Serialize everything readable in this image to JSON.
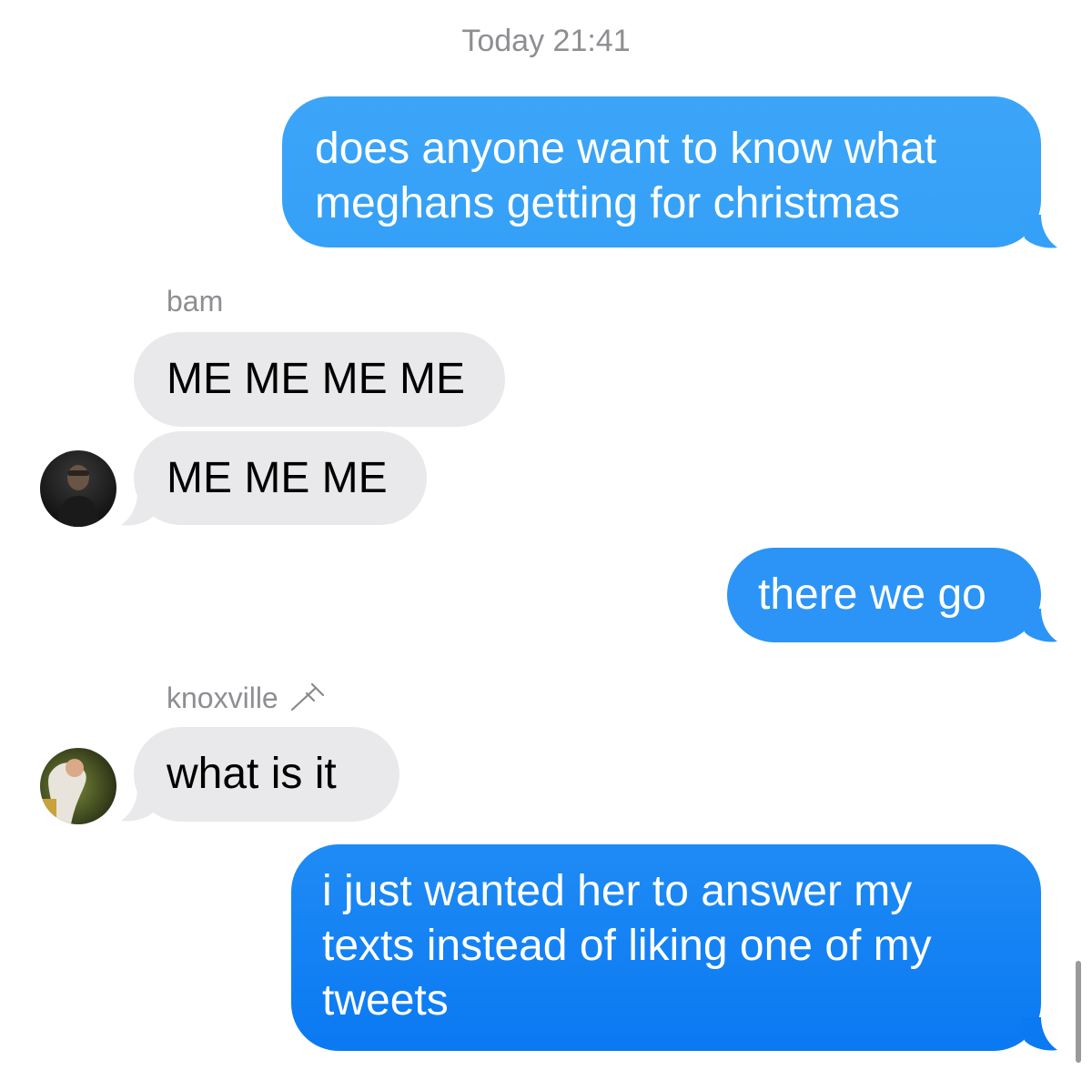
{
  "conversation": {
    "timestamp": "Today 21:41",
    "messages": [
      {
        "id": "m1",
        "direction": "outgoing",
        "lines": [
          "does anyone want to know what",
          "meghans getting for christmas"
        ]
      },
      {
        "id": "m2",
        "direction": "incoming",
        "sender": "bam",
        "lines": [
          "ME ME ME ME"
        ]
      },
      {
        "id": "m3",
        "direction": "incoming",
        "sender": "bam",
        "lines": [
          "ME ME ME"
        ]
      },
      {
        "id": "m4",
        "direction": "outgoing",
        "lines": [
          "there we go"
        ]
      },
      {
        "id": "m5",
        "direction": "incoming",
        "sender": "knoxville",
        "lines": [
          "what is it"
        ]
      },
      {
        "id": "m6",
        "direction": "outgoing",
        "lines": [
          "i just wanted her to answer my",
          "texts instead of liking one of my",
          "tweets"
        ]
      }
    ],
    "senders": {
      "bam": {
        "name": "bam",
        "avatar": "dark-portrait-avatar"
      },
      "knoxville": {
        "name": "knoxville",
        "name_emoji": "crutch-emoji",
        "avatar": "green-portrait-avatar"
      }
    }
  },
  "colors": {
    "outgoing_bubble_top": "#3aa3f8",
    "outgoing_bubble_bottom": "#0d7cf2",
    "incoming_bubble": "#e9e9eb",
    "meta_text": "#8e8e93"
  }
}
